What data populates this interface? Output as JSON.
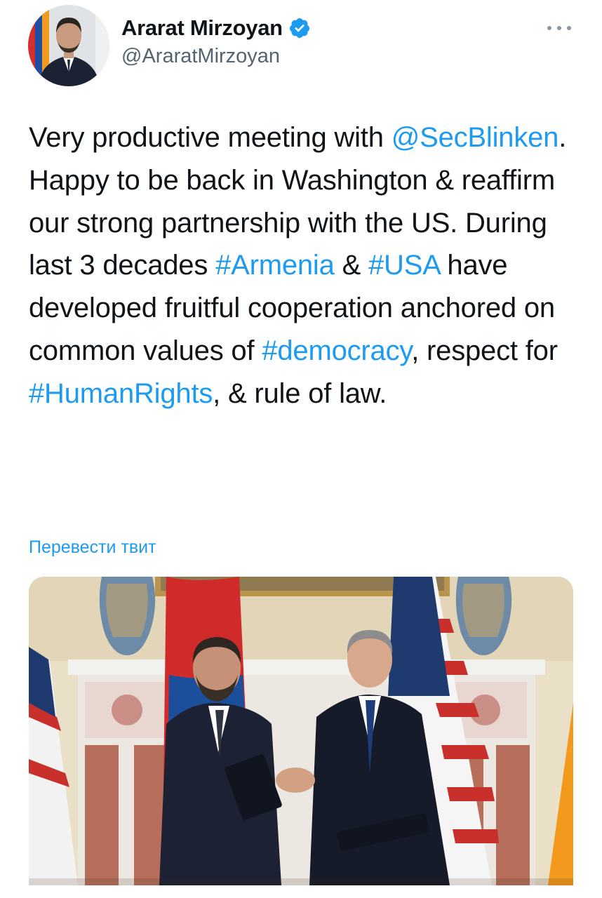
{
  "author": {
    "name": "Ararat Mirzoyan",
    "handle": "@AraratMirzoyan",
    "verified_icon": "verified-badge-icon"
  },
  "tweet": {
    "segments": [
      {
        "text": "Very productive meeting with ",
        "type": "text"
      },
      {
        "text": "@SecBlinken",
        "type": "mention"
      },
      {
        "text": ". Happy to be back in Washington & reaffirm our strong partnership with the US. During last 3 decades ",
        "type": "text"
      },
      {
        "text": "#Armenia",
        "type": "hashtag"
      },
      {
        "text": " & ",
        "type": "text"
      },
      {
        "text": "#USA",
        "type": "hashtag"
      },
      {
        "text": " have developed fruitful cooperation anchored on common values of ",
        "type": "text"
      },
      {
        "text": "#democracy",
        "type": "hashtag"
      },
      {
        "text": ", respect for ",
        "type": "text"
      },
      {
        "text": "#HumanRights",
        "type": "hashtag"
      },
      {
        "text": ", & rule of law.",
        "type": "text"
      }
    ]
  },
  "translate_label": "Перевести твит",
  "colors": {
    "link": "#1d9bf0",
    "text": "#0f1419",
    "secondary": "#536471",
    "verified": "#1d9bf0"
  }
}
